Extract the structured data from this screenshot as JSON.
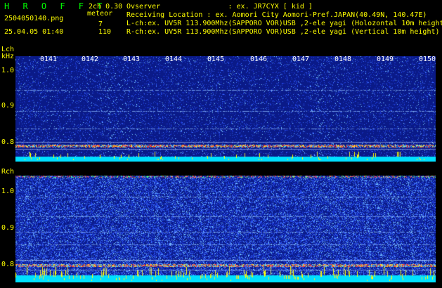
{
  "header": {
    "app_title": "H R O F F T",
    "version": "2ch 0.30",
    "filename": "2504050140.png",
    "meteor_label": "meteor",
    "datetime": "25.04.05 01:40",
    "meteor_count_l": "7",
    "meteor_count_r": "110"
  },
  "info": {
    "observer": "Ovserver                : ex. JR7CYX [ kid ]",
    "location": "Receiving Location : ex. Aomori City Aomori-Pref.JAPAN(40.49N, 140.47E)",
    "lch": "L-ch:ex. UV5R 113.900Mhz(SAPPORO VOR)USB ,2-ele yagi (Holozontal 10m height",
    "rch": "R-ch:ex. UV5R 113.900Mhz(SAPPORO VOR)USB ,2-ele yagi (Vertical 10m height)"
  },
  "lch": {
    "label": "Lch",
    "unit": "kHz",
    "yticks": [
      "1.0",
      "0.9",
      "0.8"
    ],
    "time_labels": [
      "0141",
      "0142",
      "0143",
      "0144",
      "0145",
      "0146",
      "0147",
      "0148",
      "0149",
      "0150"
    ]
  },
  "rch": {
    "label": "Rch",
    "yticks": [
      "1.0",
      "0.9",
      "0.8"
    ]
  },
  "colors": {
    "text_yellow": "#ffff00",
    "title_green": "#00ff00",
    "noise_blue": "#0a1a88",
    "signal_cyan": "#00ffff"
  }
}
